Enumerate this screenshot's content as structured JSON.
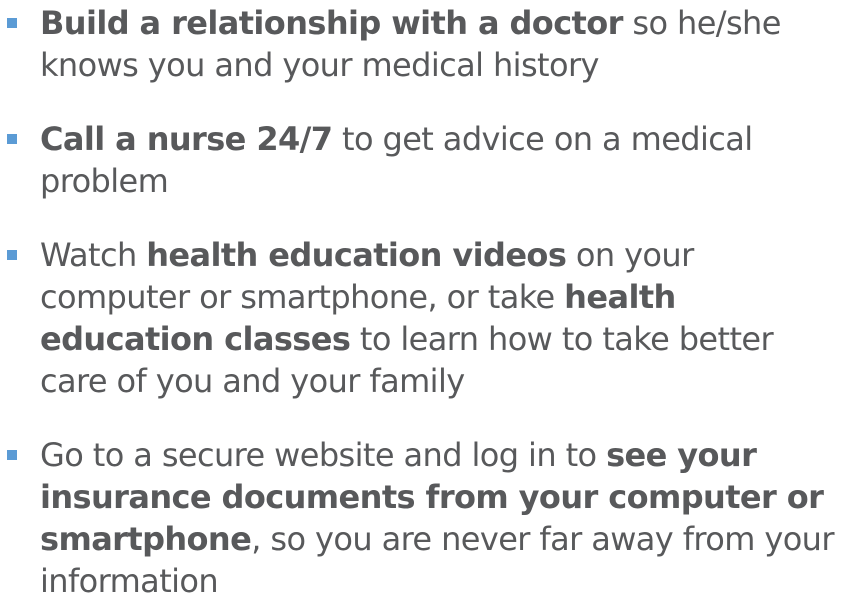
{
  "accent_color": "#5b9bd5",
  "text_color": "#58595b",
  "items": [
    {
      "bold": "Build a relationship with a doctor",
      "text_after": " so he/she knows you and your medical history"
    },
    {
      "bold": "Call a nurse 24/7",
      "text_after": " to get advice on a medical problem"
    },
    {
      "text_before": "Watch ",
      "bold1": "health education videos",
      "text_middle": " on your computer or smartphone, or take ",
      "bold2": "health education classes",
      "text_after": " to learn how to take better care of you and your family"
    },
    {
      "text_before": "Go to a secure website and log in to ",
      "bold": "see your insurance documents from your computer or smartphone",
      "text_after": ", so you are never far away from your information"
    }
  ]
}
